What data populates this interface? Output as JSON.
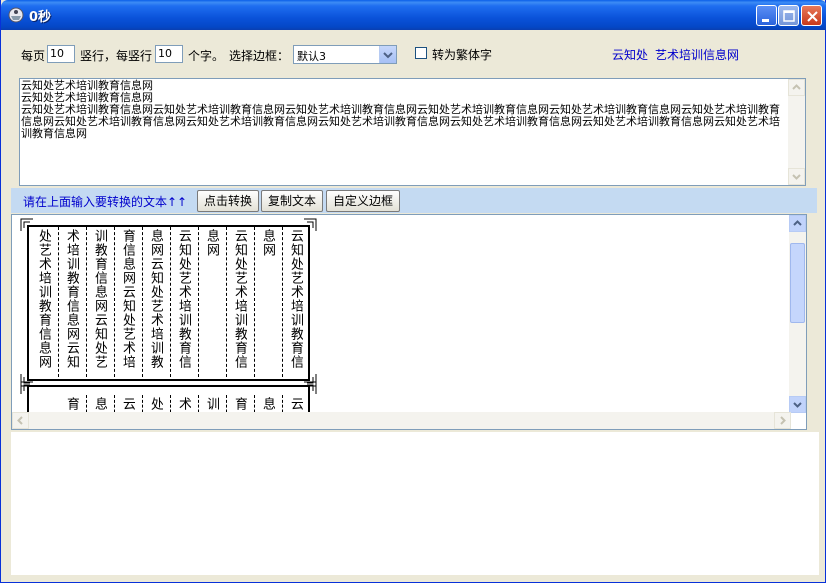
{
  "window": {
    "title": "0秒"
  },
  "options": {
    "per_page_label": "每页",
    "cols_value": "10",
    "cols_label": "竖行，每竖行",
    "chars_value": "10",
    "chars_label": "个字。",
    "border_label": "选择边框：",
    "border_selected": "默认3",
    "traditional_label": "转为繁体字",
    "links": [
      "云知处",
      "艺术培训信息网"
    ]
  },
  "input": {
    "text": "云知处艺术培训教育信息网\n云知处艺术培训教育信息网\n云知处艺术培训教育信息网云知处艺术培训教育信息网云知处艺术培训教育信息网云知处艺术培训教育信息网云知处艺术培训教育信息网云知处艺术培训教育信息网云知处艺术培训教育信息网云知处艺术培训教育信息网云知处艺术培训教育信息网云知处艺术培训教育信息网云知处艺术培训教育信息网云知处艺术培训教育信息网"
  },
  "toolbar": {
    "hint": "请在上面输入要转换的文本↑↑",
    "convert_label": "点击转换",
    "copy_label": "复制文本",
    "custom_border_label": "自定义边框"
  },
  "output": {
    "page1_columns": [
      "云知处艺术培训教育信",
      "息网",
      "云知处艺术培训教育信",
      "息网",
      "云知处艺术培训教育信",
      "息网云知处艺术培训教",
      "育信息网云知处艺术培",
      "训教育信息网云知处艺",
      "术培训教育信息网云知",
      "处艺术培训教育信息网"
    ],
    "page2_columns": [
      "云",
      "息",
      "育",
      "训",
      "术",
      "处",
      "云",
      "息",
      "育"
    ]
  }
}
